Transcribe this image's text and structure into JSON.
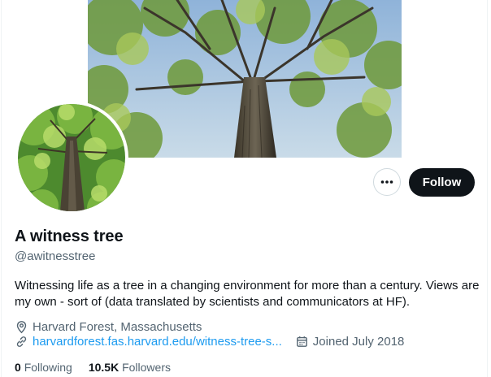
{
  "profile": {
    "display_name": "A witness tree",
    "handle": "@awitnesstree",
    "bio": "Witnessing life as a tree in a changing environment for more than a century. Views are my own - sort of (data translated by scientists and communicators at HF).",
    "location": "Harvard Forest, Massachusetts",
    "website": "harvardforest.fas.harvard.edu/witness-tree-s...",
    "joined": "Joined July 2018"
  },
  "actions": {
    "follow_label": "Follow",
    "more_icon": "more-horizontal-icon"
  },
  "stats": {
    "following_count": "0",
    "following_label": "Following",
    "followers_count": "10.5K",
    "followers_label": "Followers"
  },
  "colors": {
    "accent_link": "#1d9bf0",
    "follow_button_bg": "#0f1419",
    "secondary_text": "#536471"
  }
}
